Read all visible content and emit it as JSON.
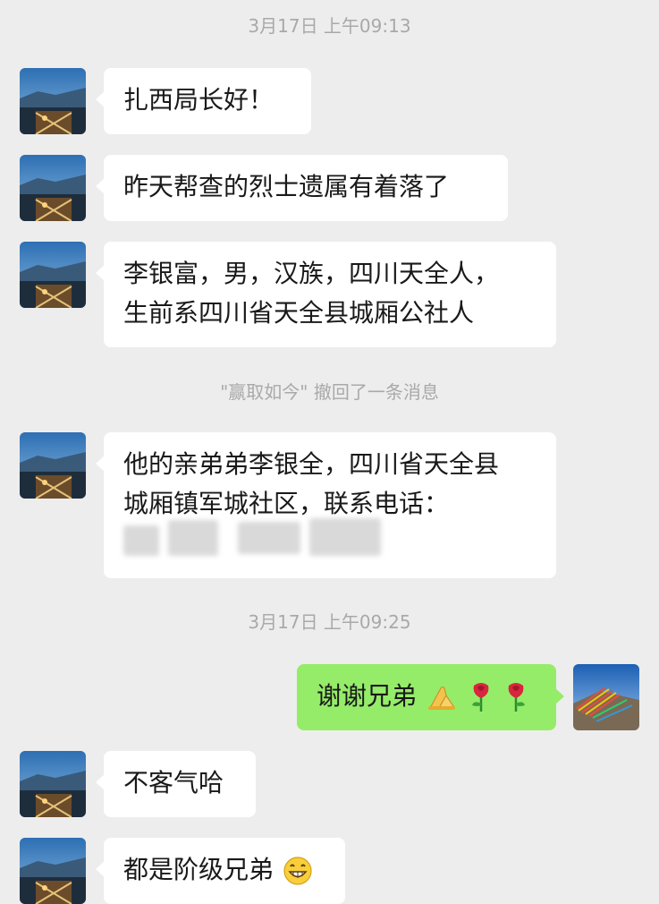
{
  "timestamps": {
    "first": "3月17日 上午09:13",
    "second": "3月17日 上午09:25"
  },
  "recall_notice": "\"赢取如今\" 撤回了一条消息",
  "messages": {
    "m1": "扎西局长好！",
    "m2": "昨天帮查的烈士遗属有着落了",
    "m3_line1": "李银富，男，汉族，四川天全人，",
    "m3_line2": "生前系四川省天全县城厢公社人",
    "m4_line1": "他的亲弟弟李银全，四川省天全县",
    "m4_line2": "城厢镇军城社区，联系电话：",
    "m5_out": "谢谢兄弟",
    "m6": "不客气哈",
    "m7": "都是阶级兄弟"
  },
  "icons": {
    "praying_hands": "praying-hands-icon",
    "rose": "rose-icon",
    "grinning": "grinning-face-icon"
  },
  "colors": {
    "background": "#ededed",
    "incoming_bubble": "#ffffff",
    "outgoing_bubble": "#95ec69",
    "system_text": "#a9a9a9"
  }
}
